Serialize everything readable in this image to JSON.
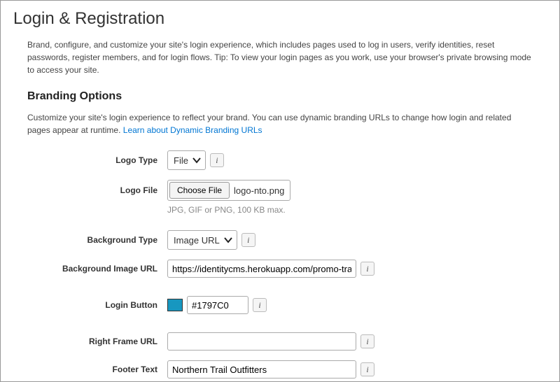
{
  "page": {
    "title": "Login & Registration",
    "intro": "Brand, configure, and customize your site's login experience, which includes pages used to log in users, verify identities, reset passwords, register members, and for login flows. Tip: To view your login pages as you work, use your browser's private browsing mode to access your site."
  },
  "branding": {
    "heading": "Branding Options",
    "desc_prefix": "Customize your site's login experience to reflect your brand. You can use dynamic branding URLs to change how login and related pages appear at runtime. ",
    "link_label": "Learn about Dynamic Branding URLs"
  },
  "fields": {
    "logo_type": {
      "label": "Logo Type",
      "value": "File"
    },
    "logo_file": {
      "label": "Logo File",
      "button": "Choose File",
      "filename": "logo-nto.png",
      "hint": "JPG, GIF or PNG, 100 KB max."
    },
    "bg_type": {
      "label": "Background Type",
      "value": "Image URL"
    },
    "bg_url": {
      "label": "Background Image URL",
      "value": "https://identitycms.herokuapp.com/promo-transp"
    },
    "login_button": {
      "label": "Login Button",
      "value": "#1797C0",
      "swatch": "#1797C0"
    },
    "right_frame": {
      "label": "Right Frame URL",
      "value": ""
    },
    "footer": {
      "label": "Footer Text",
      "value": "Northern Trail Outfitters"
    }
  }
}
